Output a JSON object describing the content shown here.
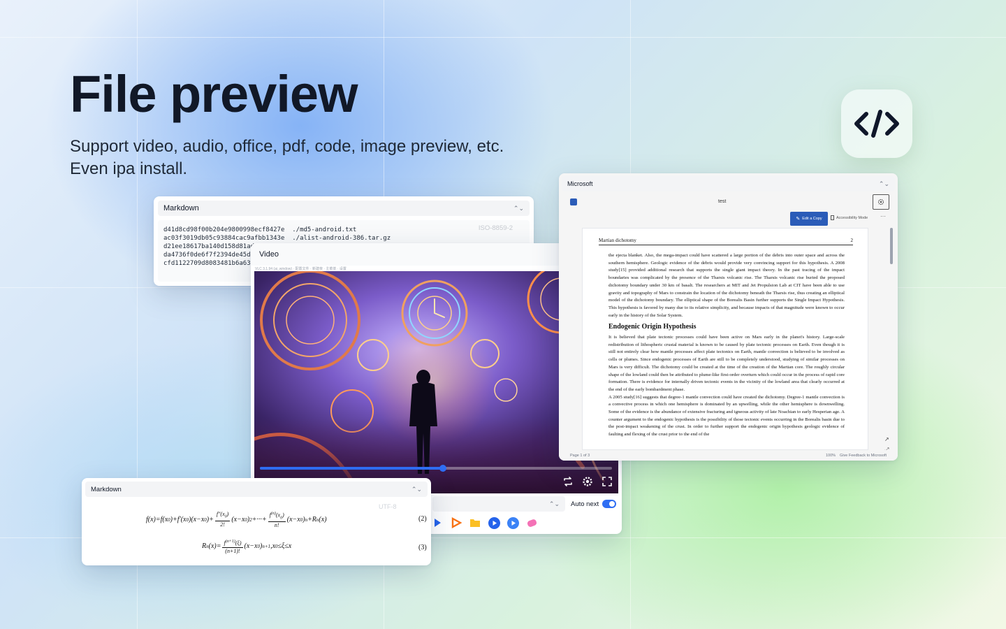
{
  "hero": {
    "title": "File preview",
    "subtitle_line1": "Support video, audio, office, pdf, code, image preview, etc.",
    "subtitle_line2": "Even ipa install."
  },
  "markdown_card": {
    "select_label": "Markdown",
    "encoding": "ISO-8859-2",
    "lines": [
      "d41d8cd98f00b204e9800998ecf8427e  ./md5-android.txt",
      "ac03f3019db05c93884cac9afbb1343e  ./alist-android-386.tar.gz",
      "d21ee18617ba140d158d81ad3",
      "da4736f0de6f7f2394de45d0c",
      "cfd1122709d8083481b6a63"
    ]
  },
  "video_card": {
    "title": "Video",
    "info": "VLC 3.1.94 (ai_window) · 配置文件 · 新建夜 · 主菜单 · 设置",
    "progress": 0.52,
    "auto_next_label": "Auto next",
    "auto_next": true,
    "players": [
      "play",
      "infuse",
      "files",
      "vlc",
      "iina",
      "potplayer"
    ]
  },
  "word_card": {
    "select_label": "Microsoft",
    "doc_name": "test",
    "edit_copy": "Edit a Copy",
    "accessibility": "Accessibility Mode",
    "more": "···",
    "header_left": "Martian dichotomy",
    "header_right": "2",
    "para1": "the ejecta blanket. Also, the mega-impact could have scattered a large portion of the debris into outer space and across the southern hemisphere. Geologic evidence of the debris would provide very convincing support for this hypothesis. A 2008 study[15] provided additional research that supports the single giant impact theory. In the past tracing of the impact boundaries was complicated by the presence of the Tharsis volcanic rise. The Tharsis volcanic rise buried the proposed dichotomy boundary under 30 km of basalt. The researchers at MIT and Jet Propulsion Lab at CIT have been able to use gravity and topography of Mars to constrain the location of the dichotomy beneath the Tharsis rise, thus creating an elliptical model of the dichotomy boundary. The elliptical shape of the Borealis Basin further supports the Single Impact Hypothesis. This hypothesis is favored by many due to its relative simplicity, and because impacts of that magnitude were known to occur early in the history of the Solar System.",
    "heading": "Endogenic Origin Hypothesis",
    "para2": "It is believed that plate tectonic processes could have been active on Mars early in the planet's history. Large-scale redistribution of lithospheric crustal material is known to be caused by plate tectonic processes on Earth. Even though it is still not entirely clear how mantle processes affect plate tectonics on Earth, mantle convection is believed to be involved as cells or plumes. Since endogenic processes of Earth are still to be completely understood, studying of similar processes on Mars is very difficult. The dichotomy could be created at the time of the creation of the Martian core. The roughly circular shape of the lowland could then be attributed to plume-like first-order overturn which could occur in the process of rapid core formation. There is evidence for internally driven tectonic events in the vicinity of the lowland area that clearly occurred at the end of the early bombardment phase.",
    "para3": "A 2005 study[16] suggests that degree-1 mantle convection could have created the dichotomy. Degree-1 mantle convection is a convective process in which one hemisphere is dominated by an upwelling, while the other hemisphere is downwelling. Some of the evidence is the abundance of extensive fracturing and igneous activity of late Noachian to early Hesperian age. A counter argument to the endogenic hypothesis is the possibility of those tectonic events occurring in the Borealis basin due to the post-impact weakening of the crust. In order to further support the endogenic origin hypothesis geologic evidence of faulting and flexing of the crust prior to the end of the",
    "page_status": "Page 1 of 3",
    "zoom": "100%",
    "feedback": "Give Feedback to Microsoft"
  },
  "math_card": {
    "select_label": "Markdown",
    "encoding": "UTF-8",
    "eq2_number": "(2)",
    "eq3_number": "(3)"
  },
  "colors": {
    "accent": "#2f6ef3",
    "title": "#111827",
    "word_blue": "#2b5cb8"
  }
}
